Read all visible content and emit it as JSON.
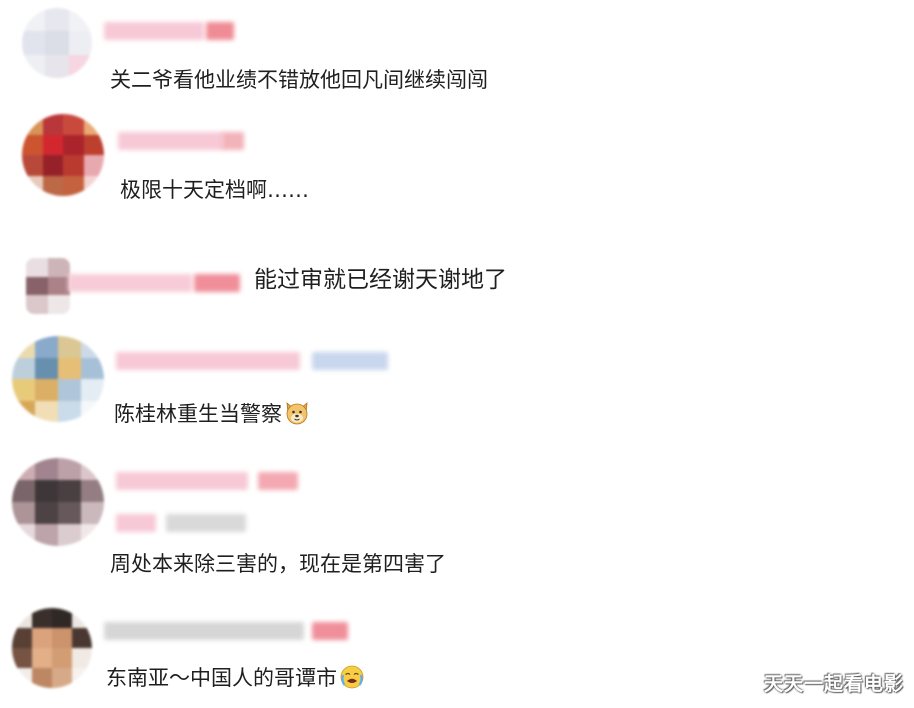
{
  "comments": [
    {
      "text": "关二爷看他业绩不错放他回凡间继续闯闯"
    },
    {
      "text": "极限十天定档啊……"
    },
    {
      "text": "能过审就已经谢天谢地了"
    },
    {
      "text": "陈桂林重生当警察",
      "emoji": "dog-face-emoji"
    },
    {
      "text": "周处本来除三害的，现在是第四害了"
    },
    {
      "text": "东南亚～中国人的哥谭市",
      "emoji": "crying-face-emoji"
    }
  ],
  "watermark": "天天一起看电影",
  "colors": {
    "name_pink": "#f7c6d2",
    "name_red": "#f08c95",
    "name_gray": "#d9d9d9",
    "name_blue": "#c8d6ee",
    "text": "#1f1f1f"
  }
}
